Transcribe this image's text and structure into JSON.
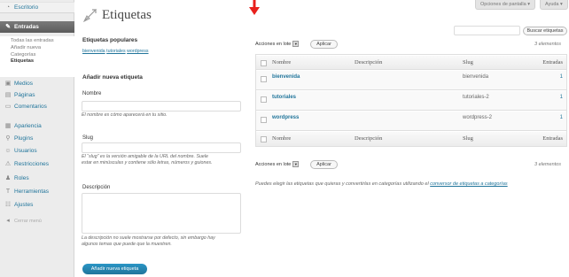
{
  "sidebar": {
    "escritorio": "Escritorio",
    "entradas": "Entradas",
    "submenu": [
      "Todas las entradas",
      "Añadir nueva",
      "Categorías",
      "Etiquetas"
    ],
    "items": [
      "Medios",
      "Páginas",
      "Comentarios",
      "Apariencia",
      "Plugins",
      "Usuarios",
      "Restricciones",
      "Roles",
      "Herramientas",
      "Ajustes",
      "Cerrar menú"
    ]
  },
  "header": {
    "title": "Etiquetas",
    "screen_options": "Opciones de pantalla ▾",
    "help": "Ayuda ▾"
  },
  "popular": {
    "heading": "Etiquetas populares",
    "tags": [
      "bienvenida",
      "tutoriales",
      "wordpress"
    ]
  },
  "add_tag": {
    "heading": "Añadir nueva etiqueta",
    "name_label": "Nombre",
    "name_hint": "El nombre es cómo aparecerá en tu sitio.",
    "slug_label": "Slug",
    "slug_hint_1": "El “slug” es la versión amigable de la URL del nombre. Suele",
    "slug_hint_2": "estar en minúsculas y contiene sólo letras, números y guiones.",
    "desc_label": "Descripción",
    "desc_hint_1": "La descripción no suele mostrarse por defecto, sin embargo hay",
    "desc_hint_2": "algunos temas que puede que la muestren.",
    "submit": "Añadir nueva etiqueta"
  },
  "search": {
    "placeholder": "",
    "button": "Buscar etiquetas"
  },
  "bulk": {
    "label": "Acciones en lote",
    "apply": "Aplicar",
    "count": "3 elementos"
  },
  "table": {
    "headers": [
      "Nombre",
      "Descripción",
      "Slug",
      "Entradas"
    ],
    "rows": [
      {
        "name": "bienvenida",
        "description": "",
        "slug": "bienvenida",
        "count": "1"
      },
      {
        "name": "tutoriales",
        "description": "",
        "slug": "tutoriales-2",
        "count": "1"
      },
      {
        "name": "wordpress",
        "description": "",
        "slug": "wordpress-2",
        "count": "1"
      }
    ]
  },
  "footer_note": {
    "text": "Puedes elegir las etiquetas que quieras y convertirlas en categorías utilizando el ",
    "link": "conversor de etiquetas a categorías"
  },
  "colors": {
    "link": "#21759b",
    "primary": "#21759b",
    "arrow": "#e8201c"
  }
}
